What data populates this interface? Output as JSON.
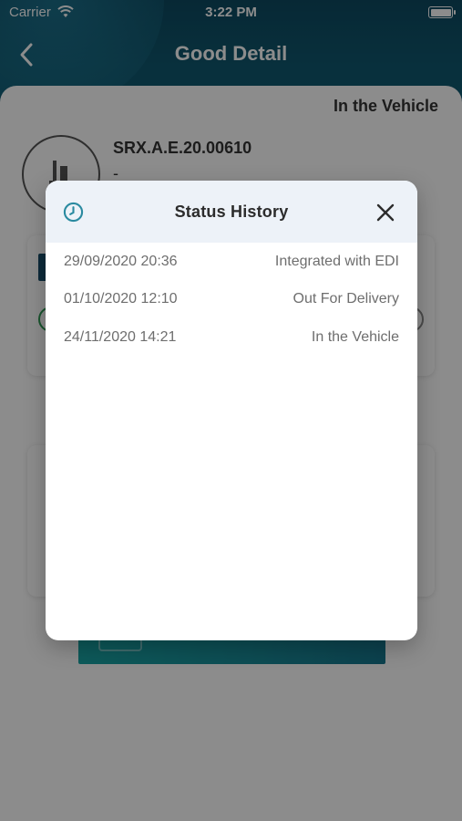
{
  "status_bar": {
    "carrier": "Carrier",
    "time": "3:22 PM"
  },
  "header": {
    "title": "Good Detail"
  },
  "detail": {
    "current_status": "In the Vehicle",
    "reference": "SRX.A.E.20.00610",
    "subtitle": "-"
  },
  "modal": {
    "title": "Status History",
    "entries": [
      {
        "date": "29/09/2020 20:36",
        "status": "Integrated with EDI"
      },
      {
        "date": "01/10/2020 12:10",
        "status": "Out For Delivery"
      },
      {
        "date": "24/11/2020 14:21",
        "status": "In the Vehicle"
      }
    ]
  },
  "colors": {
    "header_bg": "#0f5a72",
    "accent_teal": "#2a8aa0",
    "modal_header_bg": "#edf2f8",
    "overlay": "rgba(0,0,0,0.45)"
  },
  "icons": {
    "back": "chevron-left-icon",
    "clock": "clock-icon",
    "close": "close-icon",
    "wifi": "wifi-icon",
    "battery": "battery-icon",
    "avatar": "forklift-icon"
  }
}
